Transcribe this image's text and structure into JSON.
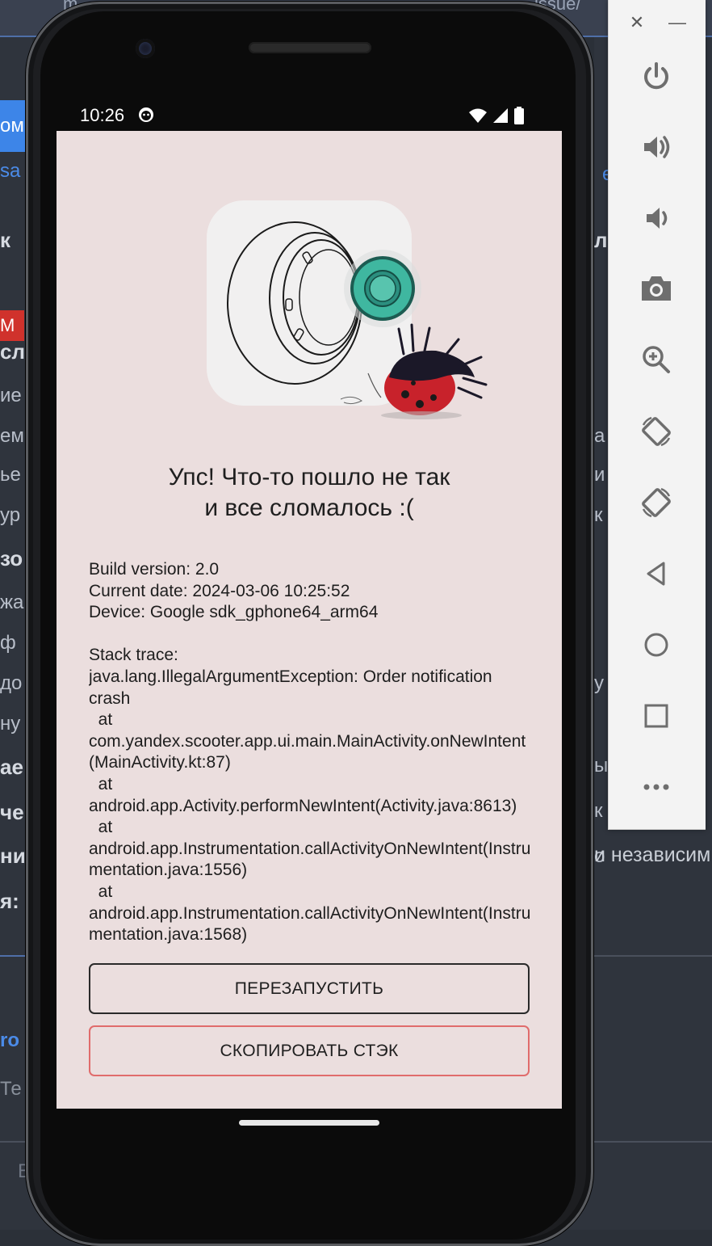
{
  "background": {
    "title_left": "m",
    "title_right": "issue/",
    "left_fragments": [
      "ом",
      "sa",
      "к",
      "М",
      "сл",
      "ие",
      "ем",
      "ье",
      "ур",
      "зо",
      "жа",
      "ф",
      "до",
      "ну",
      "ае",
      "че",
      "ни",
      "я:",
      "ro",
      "Те"
    ],
    "right_fragments": [
      "е",
      "л",
      "а",
      "и",
      "к",
      "у",
      "ы",
      "к",
      "о"
    ],
    "right_text": "и независим",
    "bottom_text": "B"
  },
  "emulator_toolbar": {
    "close_glyph": "✕",
    "minimize_glyph": "—",
    "buttons": [
      "power",
      "volume-up",
      "volume-down",
      "camera",
      "zoom",
      "rotate-left",
      "rotate-right",
      "back",
      "home",
      "overview",
      "more"
    ]
  },
  "status_bar": {
    "time": "10:26"
  },
  "crash_screen": {
    "title_line1": "Упс! Что-то пошло не так",
    "title_line2": "и все сломалось :(",
    "info": {
      "build": "Build version: 2.0",
      "date": "Current date: 2024-03-06 10:25:52",
      "device": "Device: Google sdk_gphone64_arm64"
    },
    "stack_header": "Stack trace:",
    "stack_lines": [
      "java.lang.IllegalArgumentException: Order notification crash",
      "  at",
      "com.yandex.scooter.app.ui.main.MainActivity.onNewIntent(MainActivity.kt:87)",
      "  at",
      "android.app.Activity.performNewIntent(Activity.java:8613)",
      "  at",
      "android.app.Instrumentation.callActivityOnNewIntent(Instrumentation.java:1556)",
      "  at",
      "android.app.Instrumentation.callActivityOnNewIntent(Instrumentation.java:1568)"
    ],
    "restart_button": "ПЕРЕЗАПУСТИТЬ",
    "copy_button": "СКОПИРОВАТЬ СТЭК"
  },
  "colors": {
    "screen_bg": "#ebdede",
    "copy_border": "#e06c6c",
    "toolbar_bg": "#f3f3f3",
    "icon_grey": "#6e6e6e",
    "accent_teal": "#3fb7a0"
  }
}
